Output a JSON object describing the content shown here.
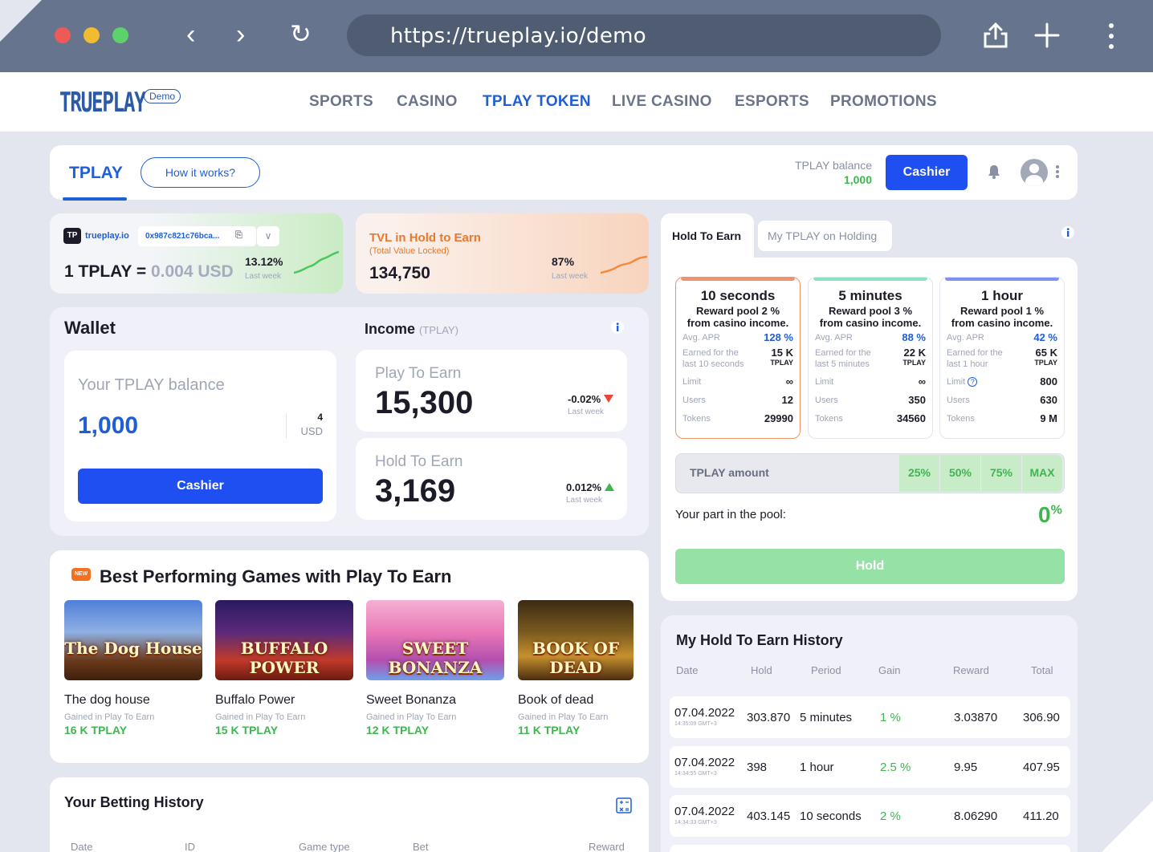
{
  "browser": {
    "url": "https://trueplay.io/demo",
    "colors": {
      "close": "#ec5b56",
      "minimize": "#f1bc31",
      "maximize": "#5dd16c"
    }
  },
  "site": {
    "logo": "TRUEPLAY",
    "demo_badge": "Demo",
    "nav": [
      "SPORTS",
      "CASINO",
      "TPLAY TOKEN",
      "LIVE CASINO",
      "ESPORTS",
      "PROMOTIONS"
    ],
    "nav_active": "TPLAY TOKEN",
    "accent": "#1f5ed6"
  },
  "topbar": {
    "tab": "TPLAY",
    "how_it_works": "How it works?",
    "balance_label": "TPLAY balance",
    "balance_value": "1,000",
    "cashier": "Cashier"
  },
  "price_card": {
    "badge": "TP",
    "site": "trueplay.io",
    "address": "0x987c821c76bca...",
    "price_prefix": "1 TPLAY =",
    "price_value": "0.004 USD",
    "change": "13.12%",
    "change_label": "Last week"
  },
  "tvl_card": {
    "title": "TVL in Hold to Earn",
    "subtitle": "(Total Value Locked)",
    "value": "134,750",
    "change": "87%",
    "change_label": "Last week"
  },
  "wallet": {
    "title": "Wallet",
    "balance_label": "Your TPLAY balance",
    "balance": "1,000",
    "usd_value": "4",
    "usd_unit": "USD",
    "cashier": "Cashier"
  },
  "income": {
    "title": "Income",
    "unit": "(TPLAY)",
    "items": [
      {
        "label": "Play To Earn",
        "value": "15,300",
        "change": "-0.02%",
        "change_label": "Last week",
        "direction": "down"
      },
      {
        "label": "Hold To Earn",
        "value": "3,169",
        "change": "0.012%",
        "change_label": "Last week",
        "direction": "up"
      }
    ]
  },
  "games": {
    "badge": "NEW",
    "title": "Best Performing Games with Play To Earn",
    "gained_label": "Gained in Play To Earn",
    "items": [
      {
        "name": "The dog house",
        "art_text": "The Dog House",
        "amount": "16 K TPLAY"
      },
      {
        "name": "Buffalo Power",
        "art_text": "BUFFALO POWER",
        "amount": "15 K TPLAY"
      },
      {
        "name": "Sweet Bonanza",
        "art_text": "SWEET BONANZA",
        "amount": "12 K TPLAY"
      },
      {
        "name": "Book of dead",
        "art_text": "BOOK OF DEAD",
        "amount": "11 K TPLAY"
      }
    ]
  },
  "betting_history": {
    "title": "Your Betting History",
    "columns": [
      "Date",
      "ID",
      "Game type",
      "Bet",
      "Reward"
    ]
  },
  "hold_to_earn": {
    "tabs": [
      "Hold To Earn",
      "My TPLAY on Holding"
    ],
    "pools": [
      {
        "title": "10 seconds",
        "line1": "Reward pool 2 %",
        "line2": "from casino income.",
        "apr_label": "Avg. APR",
        "apr": "128 %",
        "earned_label_1": "Earned for the",
        "earned_label_2": "last 10 seconds",
        "earned_value": "15 K",
        "earned_unit": "TPLAY",
        "limit_label": "Limit",
        "limit": "∞",
        "users_label": "Users",
        "users": "12",
        "tokens_label": "Tokens",
        "tokens": "29990",
        "color": "#f0936b"
      },
      {
        "title": "5 minutes",
        "line1": "Reward pool 3 %",
        "line2": "from casino income.",
        "apr_label": "Avg. APR",
        "apr": "88 %",
        "earned_label_1": "Earned for the",
        "earned_label_2": "last 5 minutes",
        "earned_value": "22 K",
        "earned_unit": "TPLAY",
        "limit_label": "Limit",
        "limit": "∞",
        "users_label": "Users",
        "users": "350",
        "tokens_label": "Tokens",
        "tokens": "34560",
        "color": "#8ee0c4"
      },
      {
        "title": "1 hour",
        "line1": "Reward pool 1 %",
        "line2": "from casino income.",
        "apr_label": "Avg. APR",
        "apr": "42 %",
        "earned_label_1": "Earned for the",
        "earned_label_2": "last 1 hour",
        "earned_value": "65 K",
        "earned_unit": "TPLAY",
        "limit_label": "Limit",
        "limit": "800",
        "users_label": "Users",
        "users": "630",
        "tokens_label": "Tokens",
        "tokens": "9 M",
        "color": "#7d8ff0"
      }
    ],
    "amount_label": "TPLAY amount",
    "quick_amounts": [
      "25%",
      "50%",
      "75%",
      "MAX"
    ],
    "part_label": "Your part in the pool:",
    "part_value": "0",
    "part_unit": "%",
    "hold_button": "Hold"
  },
  "history": {
    "title": "My Hold To Earn History",
    "columns": [
      "Date",
      "Hold",
      "Period",
      "Gain",
      "Reward",
      "Total"
    ],
    "rows": [
      {
        "date": "07.04.2022",
        "time": "14:35:09 GMT+3",
        "hold": "303.870",
        "period": "5 minutes",
        "gain": "1 %",
        "reward": "3.03870",
        "total": "306.90"
      },
      {
        "date": "07.04.2022",
        "time": "14:34:55 GMT+3",
        "hold": "398",
        "period": "1 hour",
        "gain": "2.5 %",
        "reward": "9.95",
        "total": "407.95"
      },
      {
        "date": "07.04.2022",
        "time": "14:34:33 GMT+3",
        "hold": "403.145",
        "period": "10 seconds",
        "gain": "2 %",
        "reward": "8.06290",
        "total": "411.20"
      }
    ]
  }
}
